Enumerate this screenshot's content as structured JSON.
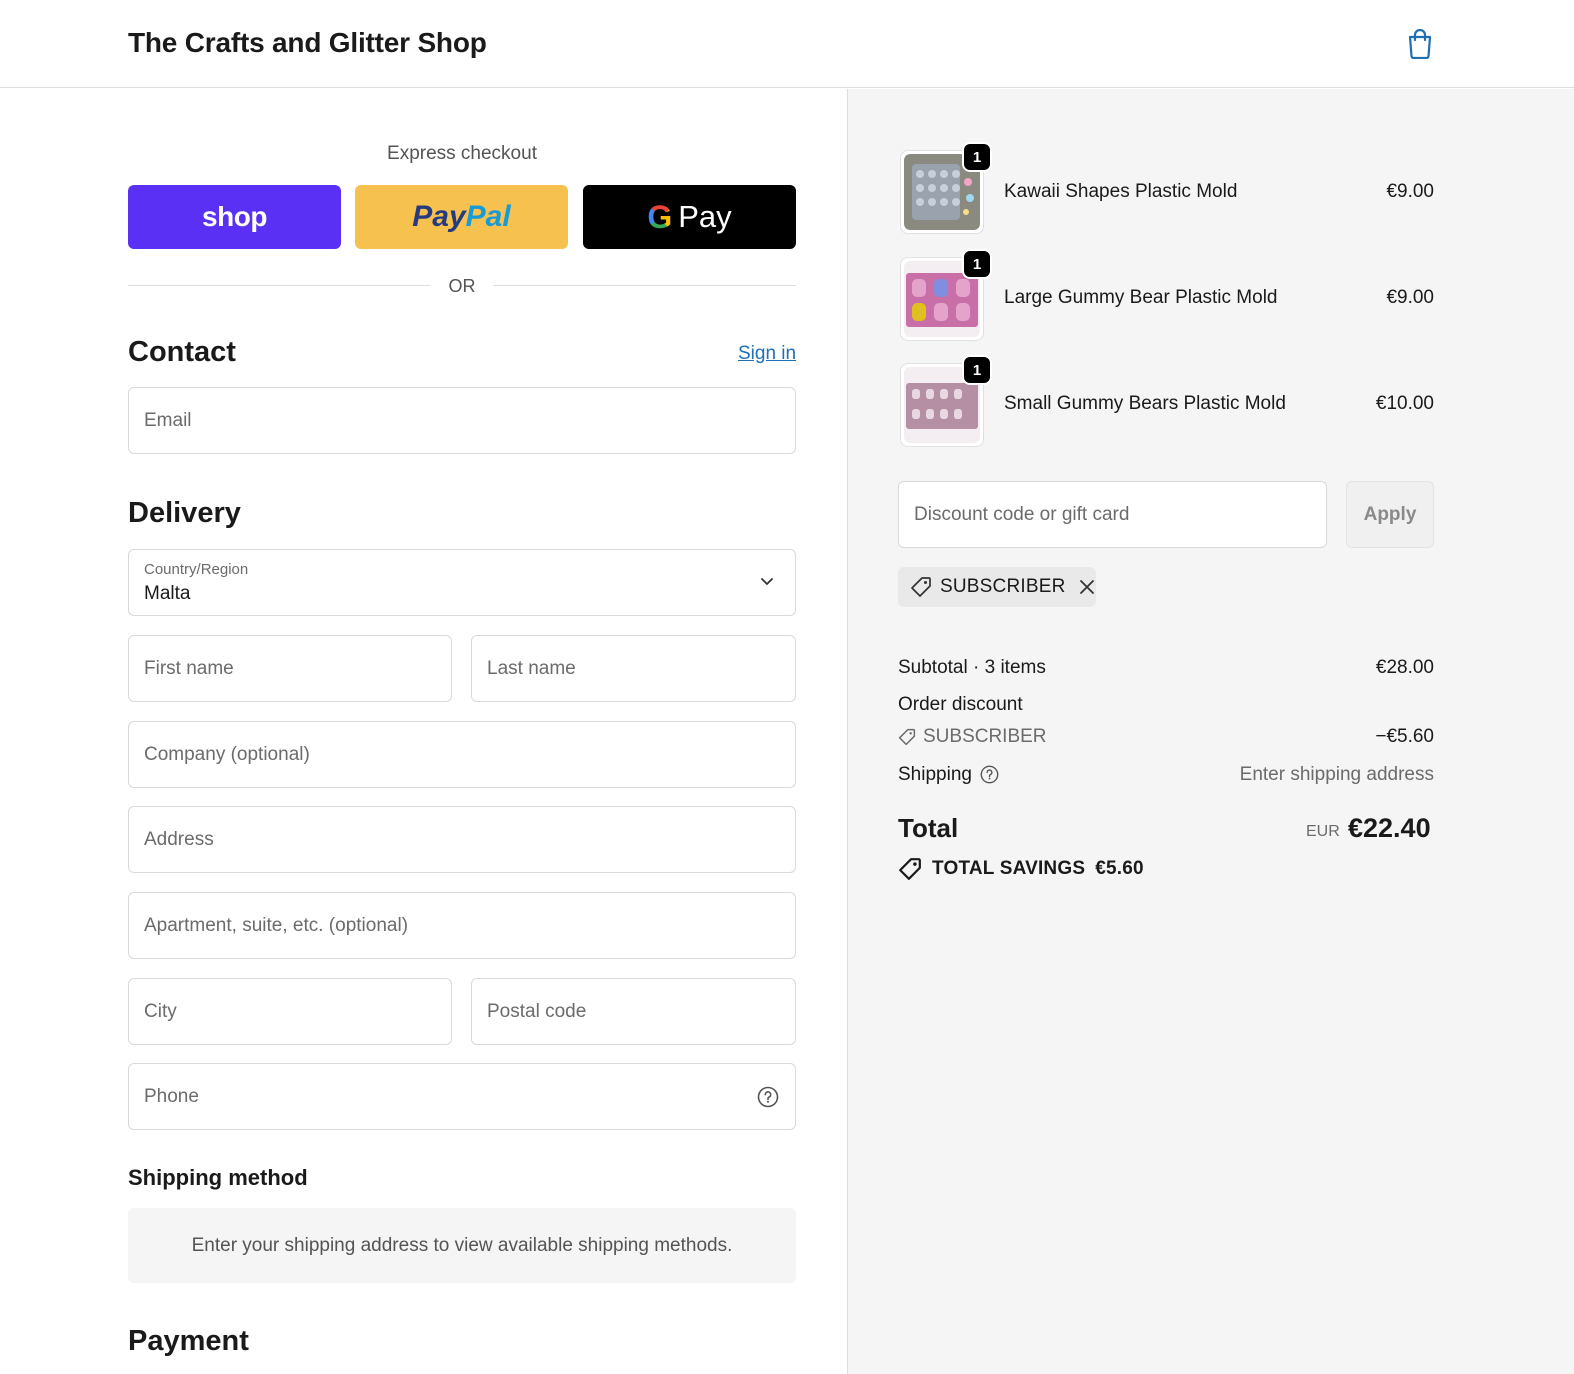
{
  "header": {
    "shop_name": "The Crafts and Glitter Shop",
    "cart_icon": "shopping-bag-icon"
  },
  "express": {
    "label": "Express checkout",
    "shop_label": "shop",
    "paypal_part1": "Pay",
    "paypal_part2": "Pal",
    "gpay_g": "G",
    "gpay_label": "Pay",
    "or_label": "OR"
  },
  "contact": {
    "title": "Contact",
    "sign_in": "Sign in",
    "email_placeholder": "Email"
  },
  "delivery": {
    "title": "Delivery",
    "country_label": "Country/Region",
    "country_value": "Malta",
    "first_name": "First name",
    "last_name": "Last name",
    "company": "Company (optional)",
    "address": "Address",
    "apartment": "Apartment, suite, etc. (optional)",
    "city": "City",
    "postal": "Postal code",
    "phone": "Phone"
  },
  "shipping_method": {
    "title": "Shipping method",
    "message": "Enter your shipping address to view available shipping methods."
  },
  "payment": {
    "title": "Payment"
  },
  "cart": {
    "items": [
      {
        "name": "Kawaii Shapes Plastic Mold",
        "price": "€9.00",
        "qty": "1"
      },
      {
        "name": "Large Gummy Bear Plastic Mold",
        "price": "€9.00",
        "qty": "1"
      },
      {
        "name": "Small Gummy Bears Plastic Mold",
        "price": "€10.00",
        "qty": "1"
      }
    ]
  },
  "discount": {
    "placeholder": "Discount code or gift card",
    "apply": "Apply",
    "applied_code": "SUBSCRIBER"
  },
  "summary": {
    "subtotal_label": "Subtotal · 3 items",
    "subtotal_value": "€28.00",
    "order_discount_label": "Order discount",
    "discount_code": "SUBSCRIBER",
    "discount_value": "−€5.60",
    "shipping_label": "Shipping",
    "shipping_value": "Enter shipping address",
    "total_label": "Total",
    "currency": "EUR",
    "total_value": "€22.40",
    "savings_label": "TOTAL SAVINGS",
    "savings_value": "€5.60"
  },
  "colors": {
    "shop_pay": "#5a31f4",
    "paypal": "#f7c150",
    "gpay": "#000000",
    "link": "#1f6fb5"
  }
}
